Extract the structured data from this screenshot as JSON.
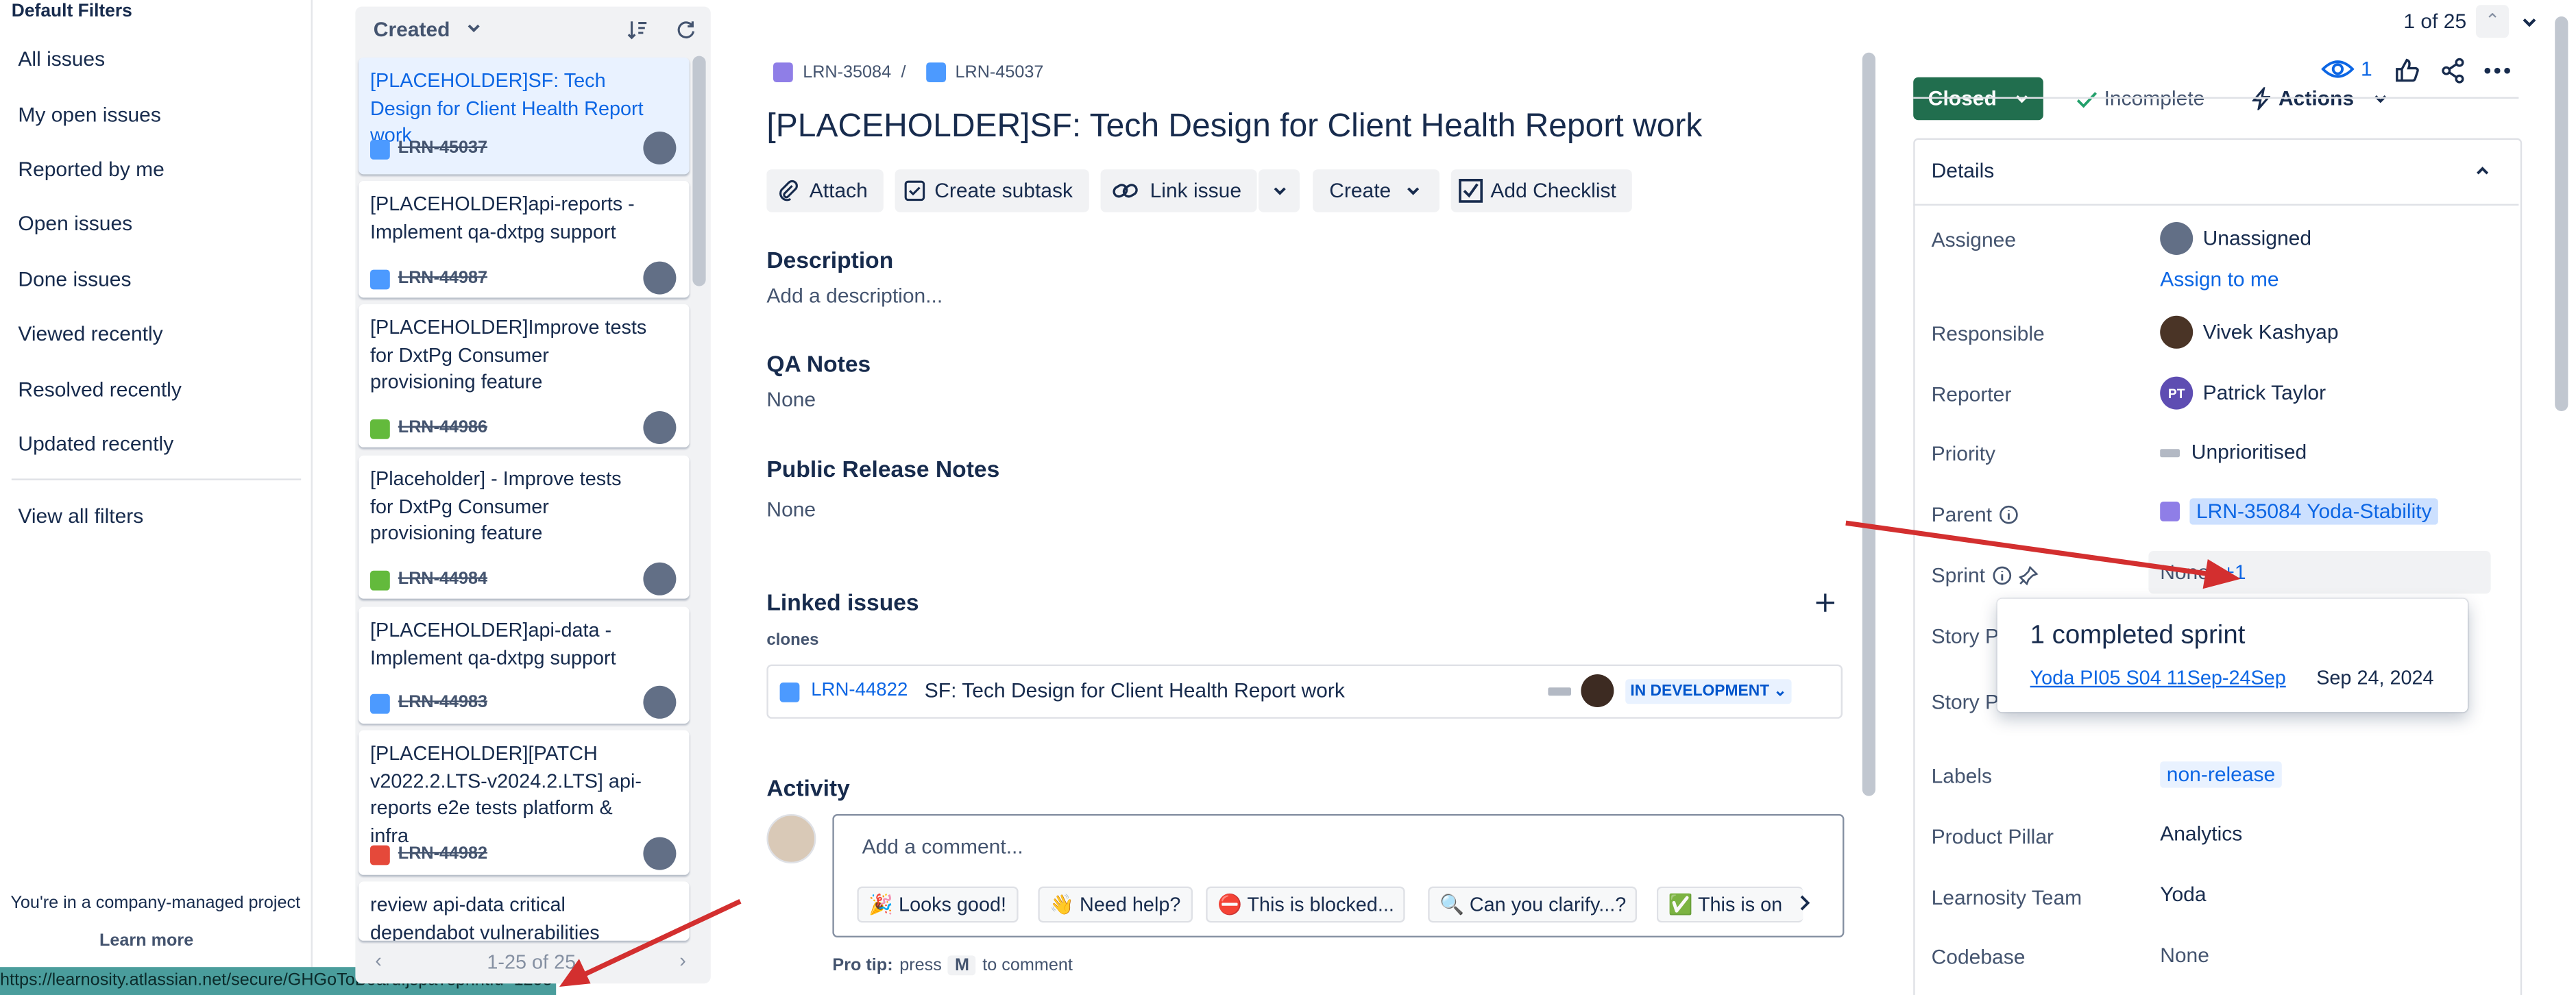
{
  "sidebar": {
    "title": "Default Filters",
    "items": [
      "All issues",
      "My open issues",
      "Reported by me",
      "Open issues",
      "Done issues",
      "Viewed recently",
      "Resolved recently",
      "Updated recently"
    ],
    "view_all": "View all filters",
    "footer_text": "You're in a company-managed project",
    "learn_more": "Learn more",
    "status_url": "https://learnosity.atlassian.net/secure/GHGoToBoard.jspa?sprintId=1258"
  },
  "list": {
    "sort_label": "Created",
    "pagination": "1-25 of 25",
    "cards": [
      {
        "title": "[PLACEHOLDER]SF: Tech Design for Client Health Report work",
        "key": "LRN-45037",
        "type": "task"
      },
      {
        "title": "[PLACEHOLDER]api-reports - Implement qa-dxtpg support",
        "key": "LRN-44987",
        "type": "task"
      },
      {
        "title": "[PLACEHOLDER]Improve tests for DxtPg Consumer provisioning feature",
        "key": "LRN-44986",
        "type": "story"
      },
      {
        "title": "[Placeholder] - Improve tests for DxtPg Consumer provisioning feature",
        "key": "LRN-44984",
        "type": "story"
      },
      {
        "title": "[PLACEHOLDER]api-data - Implement qa-dxtpg support",
        "key": "LRN-44983",
        "type": "task"
      },
      {
        "title": "[PLACEHOLDER][PATCH v2022.2.LTS-v2024.2.LTS] api-reports e2e tests platform & infra",
        "key": "LRN-44982",
        "type": "bug"
      },
      {
        "title": "review api-data critical dependabot vulnerabilities",
        "key": "",
        "type": "task"
      }
    ]
  },
  "issue": {
    "parent_key": "LRN-35084",
    "key": "LRN-45037",
    "title": "[PLACEHOLDER]SF: Tech Design for Client Health Report work",
    "toolbar": {
      "attach": "Attach",
      "create_subtask": "Create subtask",
      "link_issue": "Link issue",
      "create": "Create",
      "add_checklist": "Add Checklist"
    },
    "description_label": "Description",
    "description_placeholder": "Add a description...",
    "qa_notes_label": "QA Notes",
    "qa_notes_value": "None",
    "release_notes_label": "Public Release Notes",
    "release_notes_value": "None",
    "linked_label": "Linked issues",
    "linked_type": "clones",
    "linked": {
      "key": "LRN-44822",
      "summary": "SF: Tech Design for Client Health Report work",
      "status": "IN DEVELOPMENT"
    },
    "activity_label": "Activity",
    "comment_placeholder": "Add a comment...",
    "chips": [
      "🎉 Looks good!",
      "👋 Need help?",
      "⛔ This is blocked...",
      "🔍 Can you clarify...?",
      "✅ This is on"
    ],
    "protip_prefix": "Pro tip:",
    "protip_mid": "press",
    "protip_key": "M",
    "protip_suffix": "to comment"
  },
  "top": {
    "counter": "1 of 25",
    "watchers": "1"
  },
  "status": {
    "button": "Closed",
    "resolution": "Incomplete",
    "actions": "Actions"
  },
  "details": {
    "header": "Details",
    "assignee_label": "Assignee",
    "assignee": "Unassigned",
    "assign_to_me": "Assign to me",
    "responsible_label": "Responsible",
    "responsible": "Vivek Kashyap",
    "reporter_label": "Reporter",
    "reporter": "Patrick Taylor",
    "reporter_initials": "PT",
    "priority_label": "Priority",
    "priority": "Unprioritised",
    "parent_label": "Parent",
    "parent": "LRN-35084 Yoda-Stability",
    "sprint_label": "Sprint",
    "sprint_none": "None",
    "sprint_more": "+1",
    "story_label_1": "Story Po",
    "story_label_2": "Story Po",
    "labels_label": "Labels",
    "labels": "non-release",
    "pillar_label": "Product Pillar",
    "pillar": "Analytics",
    "team_label": "Learnosity Team",
    "team": "Yoda",
    "codebase_label": "Codebase",
    "codebase": "None"
  },
  "sprint_popup": {
    "title": "1 completed sprint",
    "sprint_name": "Yoda PI05 S04 11Sep-24Sep",
    "date": "Sep 24, 2024"
  },
  "colors": {
    "accent": "#0c66e4",
    "status_closed": "#216e4e",
    "arrow": "#d32f2f",
    "url_bar": "#4a9d9c"
  }
}
